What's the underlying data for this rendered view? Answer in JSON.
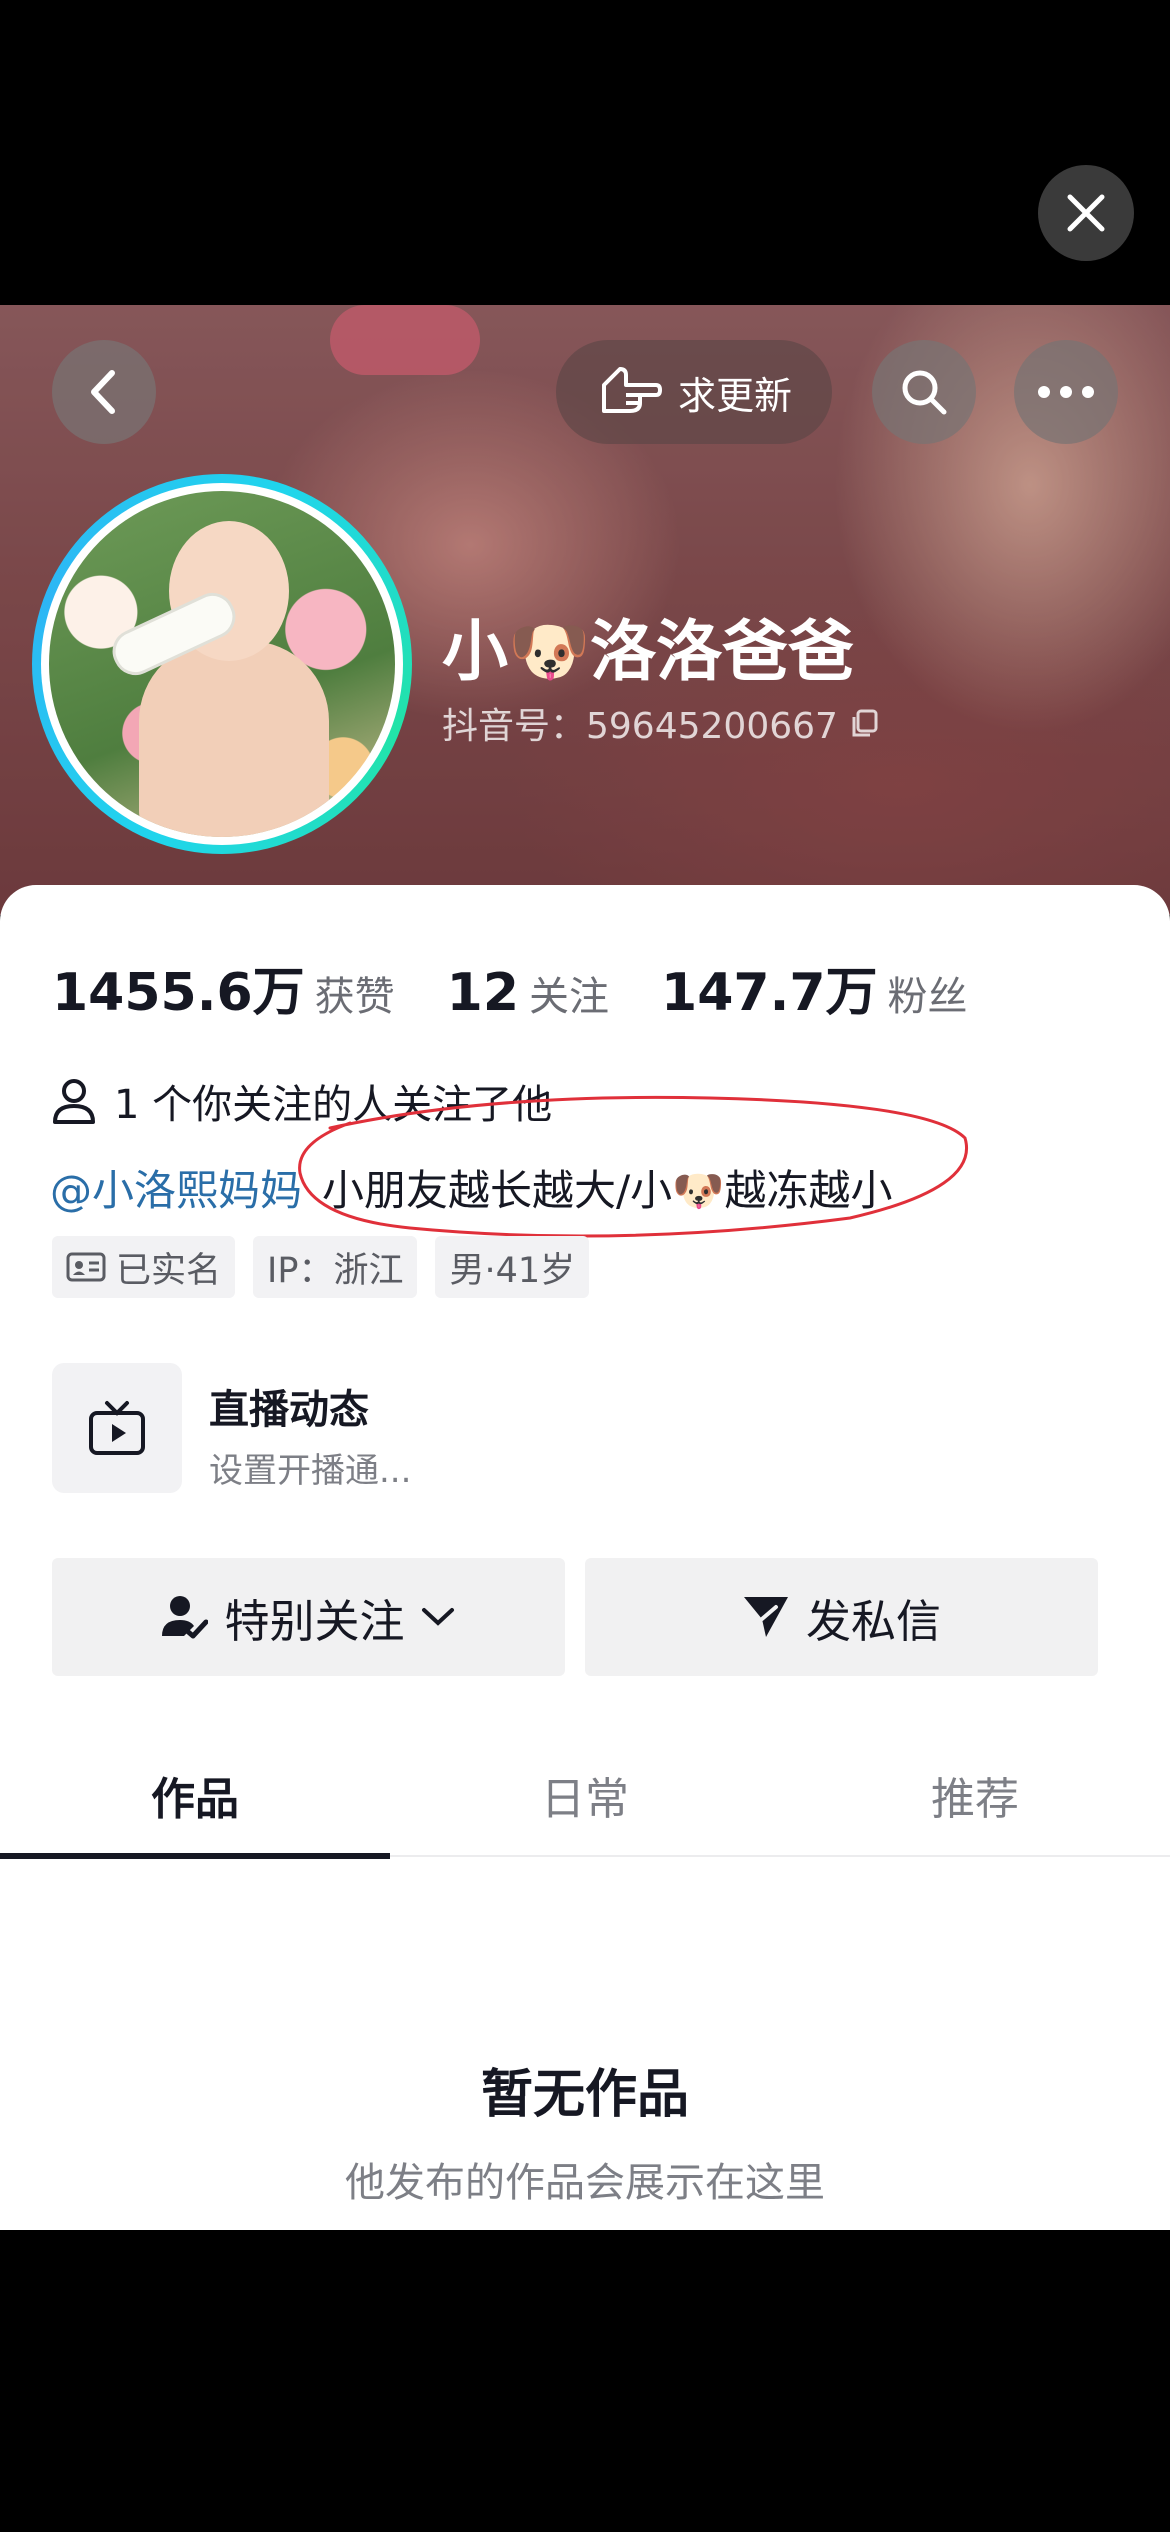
{
  "header": {
    "boost_label": "求更新"
  },
  "profile": {
    "name": "小🐶洛洛爸爸",
    "douyin_id": "抖音号：59645200667"
  },
  "stats": [
    {
      "value": "1455.6万",
      "label": "获赞"
    },
    {
      "value": "12",
      "label": "关注"
    },
    {
      "value": "147.7万",
      "label": "粉丝"
    }
  ],
  "mutual_text": "1 个你关注的人关注了他",
  "bio": {
    "mention": "@小洛熙妈妈",
    "text": "小朋友越长越大/小🐶越冻越小"
  },
  "tags": {
    "verified": "已实名",
    "ip": "IP：浙江",
    "gender_age": "男·41岁"
  },
  "live": {
    "title": "直播动态",
    "subtitle": "设置开播通..."
  },
  "actions": {
    "follow": "特别关注",
    "message": "发私信"
  },
  "tabs": [
    "作品",
    "日常",
    "推荐"
  ],
  "empty": {
    "title": "暂无作品",
    "subtitle": "他发布的作品会展示在这里"
  },
  "colors": {
    "mention": "#2a6ea8",
    "ring": "#20d5ec",
    "annotation": "#e0303a"
  }
}
